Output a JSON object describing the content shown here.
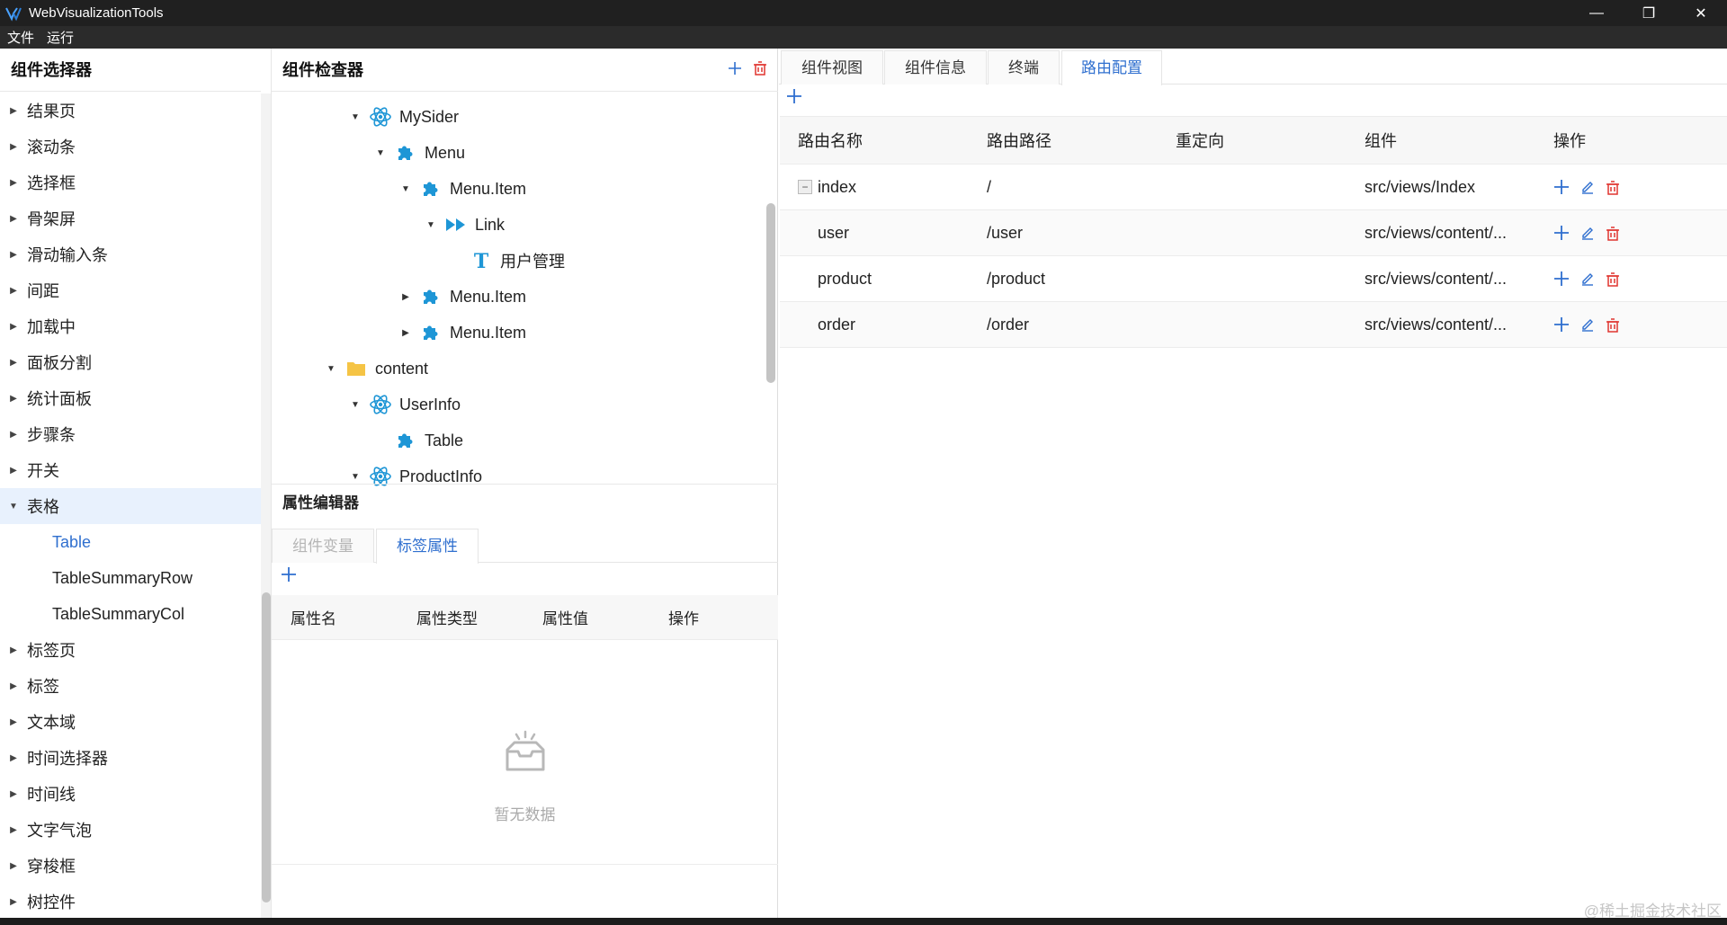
{
  "app": {
    "title": "WebVisualizationTools",
    "window_buttons": [
      "—",
      "❐",
      "✕"
    ],
    "menus": [
      "文件",
      "运行"
    ]
  },
  "selector": {
    "title": "组件选择器",
    "items": [
      {
        "label": "结果页"
      },
      {
        "label": "滚动条"
      },
      {
        "label": "选择框"
      },
      {
        "label": "骨架屏"
      },
      {
        "label": "滑动输入条"
      },
      {
        "label": "间距"
      },
      {
        "label": "加载中"
      },
      {
        "label": "面板分割"
      },
      {
        "label": "统计面板"
      },
      {
        "label": "步骤条"
      },
      {
        "label": "开关"
      }
    ],
    "expanded": {
      "label": "表格",
      "children": [
        {
          "label": "Table",
          "current": true
        },
        {
          "label": "TableSummaryRow"
        },
        {
          "label": "TableSummaryCol"
        }
      ]
    },
    "items_after": [
      {
        "label": "标签页"
      },
      {
        "label": "标签"
      },
      {
        "label": "文本域"
      },
      {
        "label": "时间选择器"
      },
      {
        "label": "时间线"
      },
      {
        "label": "文字气泡"
      },
      {
        "label": "穿梭框"
      },
      {
        "label": "树控件"
      }
    ]
  },
  "inspector": {
    "title": "组件检查器",
    "tree": [
      {
        "label": "MySider",
        "icon": "react-icon",
        "caret": "down"
      },
      {
        "label": "Menu",
        "icon": "puzzle-icon",
        "caret": "down"
      },
      {
        "label": "Menu.Item",
        "icon": "puzzle-icon",
        "caret": "down"
      },
      {
        "label": "Link",
        "icon": "forward-icon",
        "caret": "down"
      },
      {
        "label": "用户管理",
        "icon": "text-icon",
        "caret": ""
      },
      {
        "label": "Menu.Item",
        "icon": "puzzle-icon",
        "caret": "right"
      },
      {
        "label": "Menu.Item",
        "icon": "puzzle-icon",
        "caret": "right"
      },
      {
        "label": "content",
        "icon": "folder-icon",
        "caret": "down"
      },
      {
        "label": "UserInfo",
        "icon": "react-icon",
        "caret": "down"
      },
      {
        "label": "Table",
        "icon": "puzzle-icon",
        "caret": ""
      },
      {
        "label": "ProductInfo",
        "icon": "react-icon",
        "caret": "down"
      }
    ]
  },
  "properties": {
    "title": "属性编辑器",
    "tabs": [
      "组件变量",
      "标签属性"
    ],
    "columns": [
      "属性名",
      "属性类型",
      "属性值",
      "操作"
    ],
    "empty_text": "暂无数据"
  },
  "routes": {
    "tabs": [
      "组件视图",
      "组件信息",
      "终端",
      "路由配置"
    ],
    "active_tab": "路由配置",
    "columns": [
      "路由名称",
      "路由路径",
      "重定向",
      "组件",
      "操作"
    ],
    "rows": [
      {
        "name": "index",
        "path": "/",
        "redirect": "",
        "component": "src/views/Index"
      },
      {
        "name": "user",
        "path": "/user",
        "redirect": "",
        "component": "src/views/content/..."
      },
      {
        "name": "product",
        "path": "/product",
        "redirect": "",
        "component": "src/views/content/..."
      },
      {
        "name": "order",
        "path": "/order",
        "redirect": "",
        "component": "src/views/content/..."
      }
    ]
  },
  "watermark": "@稀土掘金技术社区",
  "colors": {
    "accent": "#2f6fcf",
    "danger": "#e0342f",
    "icon_blue": "#1e96d6",
    "folder": "#f5c445"
  }
}
